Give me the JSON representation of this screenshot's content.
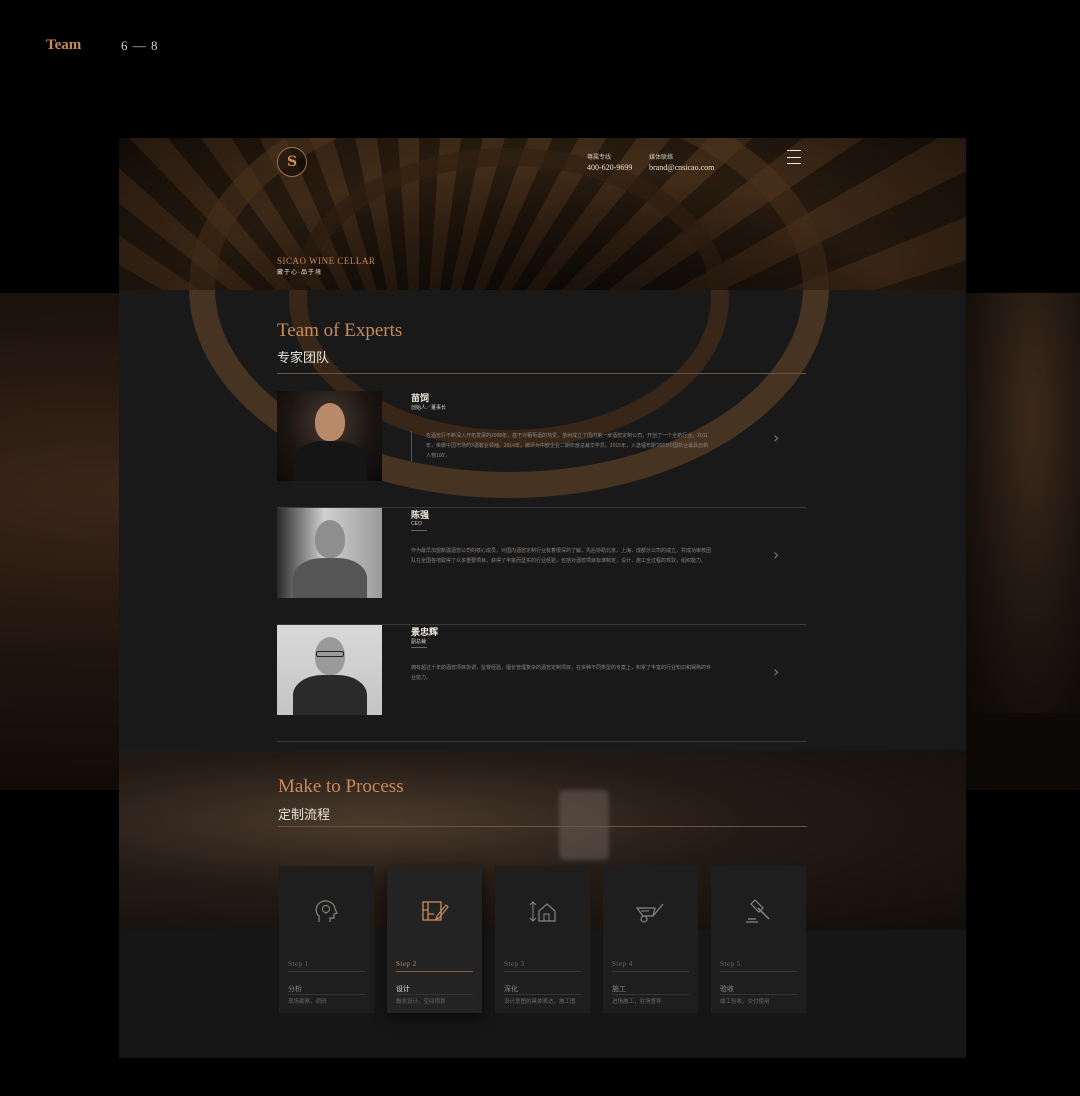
{
  "outer": {
    "title": "Team",
    "pages": "6 — 8"
  },
  "header": {
    "logo_letter": "S",
    "hotline_label": "尊属专线",
    "hotline_value": "400-620-9699",
    "email_label": "媒体联络",
    "email_value": "brand@cnsicao.com",
    "brand": "SICAO  WINE CELLAR",
    "brand_sub": "藏于心·品于境"
  },
  "experts_section": {
    "title": "Team of  Experts",
    "subtitle": "专家团队",
    "items": [
      {
        "name": "苗饲",
        "role": "创始人／董事长",
        "desc": "在酒窖行不断深入开拓发展的2008年，基于对葡萄酒的热爱，苗树成立了国内第一家酒窖定制公司，开创了一个全新行业。2011年，荣膺中国市场的3酒客业领袖。2014年，被评为中欧企业二期年度总裁华学员。2015年，入选福布斯'2015中国新业最具创新人物100'。"
      },
      {
        "name": "陈强",
        "role": "CEO",
        "desc": "作为最早加盟新疆酒窖公司的核心成员，对国内酒窖定制行业有着很深的了解，先后协助北京，上海，成都分公司的成立，并成功审核团队在全国各地取得了众多重要项目，获得了丰富而坚实的行业经验，包括对酒窖项目标准制定，设计，施工全过程的驾驭，组织能力。"
      },
      {
        "name": "景忠辉",
        "role": "副总裁",
        "desc": "拥有超过十年的酒窖项目协调，监督经验，擅长管理复杂的酒窖定制项目，在多种不同类型的专案上，积累了丰富的行业知识和娴熟的专业能力。"
      }
    ]
  },
  "process_section": {
    "title": "Make to Process",
    "subtitle": "定制流程",
    "steps": [
      {
        "name": "Step 1",
        "title": "分析",
        "desc": "现场勘察，调研",
        "icon": "head-bulb-icon"
      },
      {
        "name": "Step 2",
        "title": "设计",
        "desc": "概念设计，空间规划",
        "icon": "design-edit-icon"
      },
      {
        "name": "Step 3",
        "title": "深化",
        "desc": "设计意图的具体表达，施工图",
        "icon": "house-measure-icon"
      },
      {
        "name": "Step 4",
        "title": "施工",
        "desc": "进场施工，驻场督导",
        "icon": "wheelbarrow-icon"
      },
      {
        "name": "Step 5",
        "title": "验收",
        "desc": "竣工验收，交付使用",
        "icon": "gavel-icon"
      }
    ]
  },
  "colors": {
    "accent": "#c98a5c",
    "card": "#191919",
    "page": "#000000"
  }
}
